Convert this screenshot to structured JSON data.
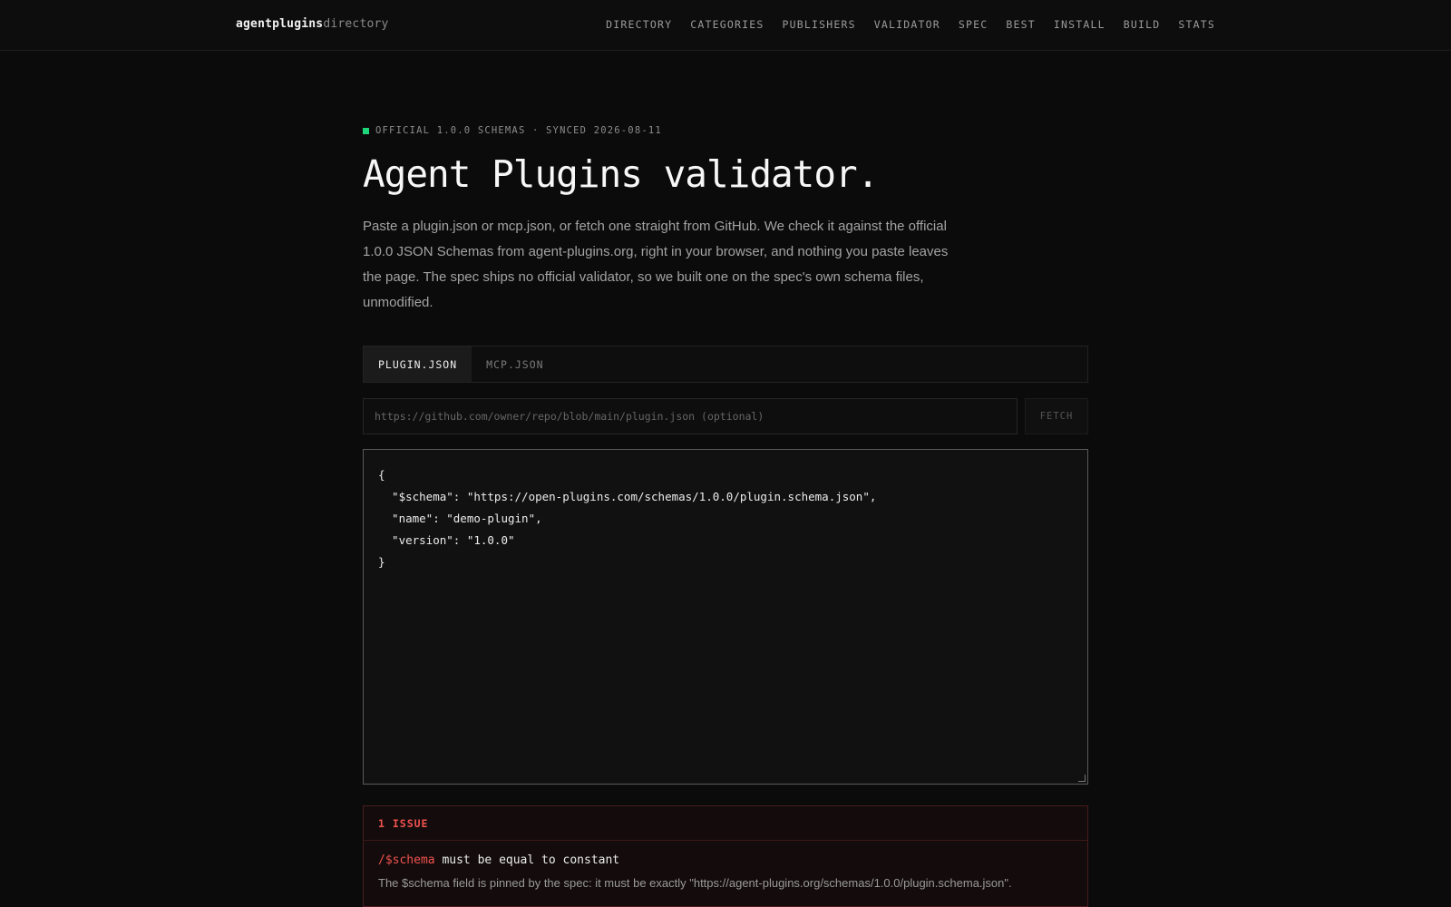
{
  "brand": {
    "primary": "agentplugins",
    "secondary": "directory"
  },
  "nav": [
    "DIRECTORY",
    "CATEGORIES",
    "PUBLISHERS",
    "VALIDATOR",
    "SPEC",
    "BEST",
    "INSTALL",
    "BUILD",
    "STATS"
  ],
  "eyebrow": "OFFICIAL 1.0.0 SCHEMAS · SYNCED 2026-08-11",
  "title": "Agent Plugins validator.",
  "lede": "Paste a plugin.json or mcp.json, or fetch one straight from GitHub. We check it against the official 1.0.0 JSON Schemas from agent-plugins.org, right in your browser, and nothing you paste leaves the page. The spec ships no official validator, so we built one on the spec's own schema files, unmodified.",
  "tabs": [
    {
      "label": "PLUGIN.JSON",
      "active": true
    },
    {
      "label": "MCP.JSON",
      "active": false
    }
  ],
  "fetch": {
    "url_value": "",
    "url_placeholder": "https://github.com/owner/repo/blob/main/plugin.json (optional)",
    "button_label": "FETCH"
  },
  "editor": {
    "content": "{\n  \"$schema\": \"https://open-plugins.com/schemas/1.0.0/plugin.schema.json\",\n  \"name\": \"demo-plugin\",\n  \"version\": \"1.0.0\"\n}"
  },
  "issues": {
    "header": "1 ISSUE",
    "items": [
      {
        "path": "/$schema",
        "message": "must be equal to constant",
        "detail": "The $schema field is pinned by the spec: it must be exactly \"https://agent-plugins.org/schemas/1.0.0/plugin.schema.json\"."
      }
    ]
  },
  "colors": {
    "accent_green": "#1ed67a",
    "error_red": "#f0524f",
    "background": "#0b0b0b"
  }
}
